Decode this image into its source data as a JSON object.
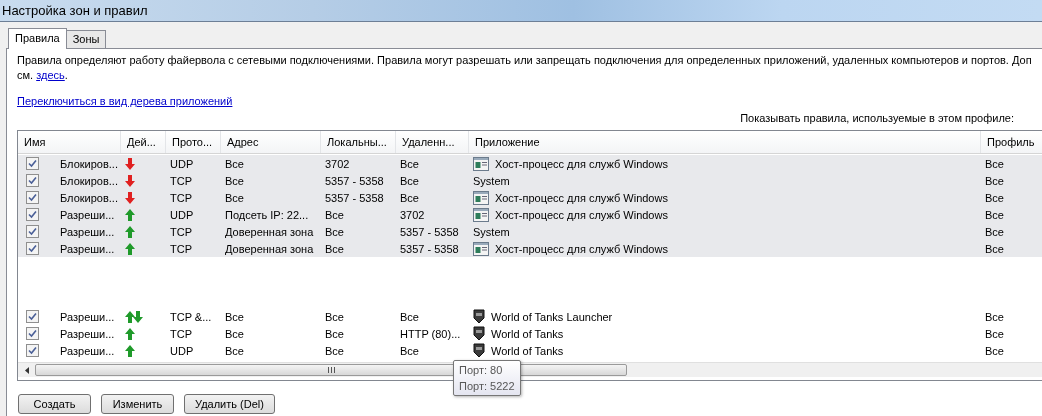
{
  "window": {
    "title": "Настройка зон и правил"
  },
  "tabs": [
    {
      "label": "Правила",
      "selected": true
    },
    {
      "label": "Зоны",
      "selected": false
    }
  ],
  "description": "Правила определяют работу файервола с сетевыми подключениями. Правила могут разрешать или запрещать подключения для определенных приложений, удаленных компьютеров и портов. Доп",
  "description_more": {
    "prefix": "см.",
    "link": "здесь",
    "suffix": "."
  },
  "tree_link": "Переключиться в вид дерева приложений",
  "profile_label": "Показывать правила, используемые в этом профиле:",
  "table": {
    "columns": [
      "Имя",
      "Дей...",
      "Прото...",
      "Адрес",
      "Локальны...",
      "Удаленн...",
      "Приложение",
      "Профиль"
    ],
    "groups": [
      {
        "rows": [
          {
            "checked": true,
            "selected": true,
            "name": "Блокиров...",
            "kind": "block",
            "protocol": "UDP",
            "address": "Все",
            "local": "3702",
            "remote": "Все",
            "app": {
              "kind": "service",
              "text": "Хост-процесс для служб Windows"
            },
            "profile": "Все"
          },
          {
            "checked": true,
            "selected": true,
            "name": "Блокиров...",
            "kind": "block",
            "protocol": "TCP",
            "address": "Все",
            "local": "5357 - 5358",
            "remote": "Все",
            "app": {
              "kind": "plain",
              "text": "System"
            },
            "profile": "Все"
          },
          {
            "checked": true,
            "selected": true,
            "name": "Блокиров...",
            "kind": "block",
            "protocol": "TCP",
            "address": "Все",
            "local": "5357 - 5358",
            "remote": "Все",
            "app": {
              "kind": "service",
              "text": "Хост-процесс для служб Windows"
            },
            "profile": "Все"
          },
          {
            "checked": true,
            "selected": true,
            "name": "Разреши...",
            "kind": "allow",
            "protocol": "UDP",
            "address": "Подсеть IP: 22...",
            "local": "Все",
            "remote": "3702",
            "app": {
              "kind": "service",
              "text": "Хост-процесс для служб Windows"
            },
            "profile": "Все"
          },
          {
            "checked": true,
            "selected": true,
            "name": "Разреши...",
            "kind": "allow",
            "protocol": "TCP",
            "address": "Доверенная зона",
            "local": "Все",
            "remote": "5357 - 5358",
            "app": {
              "kind": "plain",
              "text": "System"
            },
            "profile": "Все"
          },
          {
            "checked": true,
            "selected": true,
            "name": "Разреши...",
            "kind": "allow",
            "protocol": "TCP",
            "address": "Доверенная зона",
            "local": "Все",
            "remote": "5357 - 5358",
            "app": {
              "kind": "service",
              "text": "Хост-процесс для служб Windows"
            },
            "profile": "Все"
          }
        ]
      },
      {
        "rows": [
          {
            "checked": true,
            "selected": false,
            "name": "Разреши...",
            "kind": "both",
            "protocol": "TCP &...",
            "address": "Все",
            "local": "Все",
            "remote": "Все",
            "app": {
              "kind": "game",
              "text": "World of Tanks Launcher"
            },
            "profile": "Все"
          },
          {
            "checked": true,
            "selected": false,
            "name": "Разреши...",
            "kind": "allow",
            "protocol": "TCP",
            "address": "Все",
            "local": "Все",
            "remote": "HTTP (80)...",
            "app": {
              "kind": "game",
              "text": "World of Tanks"
            },
            "profile": "Все"
          },
          {
            "checked": true,
            "selected": false,
            "name": "Разреши...",
            "kind": "allow",
            "protocol": "UDP",
            "address": "Все",
            "local": "Все",
            "remote": "Все",
            "app": {
              "kind": "game",
              "text": "World of Tanks"
            },
            "profile": "Все"
          }
        ]
      }
    ]
  },
  "tooltip": {
    "lines": [
      "Порт: 80",
      "Порт: 5222"
    ]
  },
  "buttons": [
    "Создать",
    "Изменить",
    "Удалить (Del)"
  ]
}
